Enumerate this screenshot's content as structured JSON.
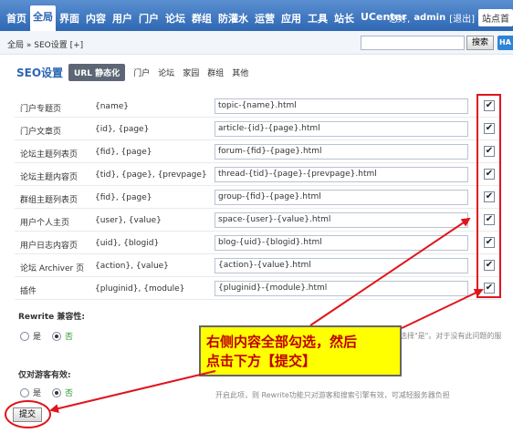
{
  "nav": {
    "items": [
      "首页",
      "全局",
      "界面",
      "内容",
      "用户",
      "门户",
      "论坛",
      "群组",
      "防灌水",
      "运营",
      "应用",
      "工具",
      "站长",
      "UCenter"
    ],
    "active_index": 1,
    "greeting": "您好,",
    "username": "admin",
    "logout": "[退出]",
    "shortcut": "站点首"
  },
  "breadcrumb": {
    "text": "全局 » SEO设置",
    "add": "[+]"
  },
  "search": {
    "button": "搜索",
    "placeholder": ""
  },
  "help_label": "HA",
  "subtabs": {
    "title": "SEO设置",
    "tabs": [
      "URL 静态化",
      "门户",
      "论坛",
      "家园",
      "群组",
      "其他"
    ],
    "active_index": 0
  },
  "rows": [
    {
      "name": "门户专题页",
      "vars": "{name}",
      "rule": "topic-{name}.html",
      "checked": true
    },
    {
      "name": "门户文章页",
      "vars": "{id}, {page}",
      "rule": "article-{id}-{page}.html",
      "checked": true
    },
    {
      "name": "论坛主题列表页",
      "vars": "{fid}, {page}",
      "rule": "forum-{fid}-{page}.html",
      "checked": true
    },
    {
      "name": "论坛主题内容页",
      "vars": "{tid}, {page}, {prevpage}",
      "rule": "thread-{tid}-{page}-{prevpage}.html",
      "checked": true
    },
    {
      "name": "群组主题列表页",
      "vars": "{fid}, {page}",
      "rule": "group-{fid}-{page}.html",
      "checked": true
    },
    {
      "name": "用户个人主页",
      "vars": "{user}, {value}",
      "rule": "space-{user}-{value}.html",
      "checked": true
    },
    {
      "name": "用户日志内容页",
      "vars": "{uid}, {blogid}",
      "rule": "blog-{uid}-{blogid}.html",
      "checked": true
    },
    {
      "name": "论坛 Archiver 页",
      "vars": "{action}, {value}",
      "rule": "{action}-{value}.html",
      "checked": true
    },
    {
      "name": "插件",
      "vars": "{pluginid}, {module}",
      "rule": "{pluginid}-{module}.html",
      "checked": true
    }
  ],
  "check_mark": "✔",
  "rewrite": {
    "title": "Rewrite 兼容性:",
    "yes": "是",
    "no": "否",
    "tip": "选择\"是\"。对于没有此问题的服"
  },
  "guest": {
    "title": "仅对游客有效:",
    "yes": "是",
    "no": "否",
    "tip": "开启此项，则 Rewrite功能只对游客和搜索引擎有效，可减轻服务器负担"
  },
  "callout": {
    "line1": "右侧内容全部勾选，然后",
    "line2": "点击下方【提交】"
  },
  "submit_label": "提交",
  "colors": {
    "nav_blue": "#2e67b3",
    "annotation_red": "#e0141c",
    "callout_yellow": "#ffff00",
    "callout_text": "#c00000"
  }
}
